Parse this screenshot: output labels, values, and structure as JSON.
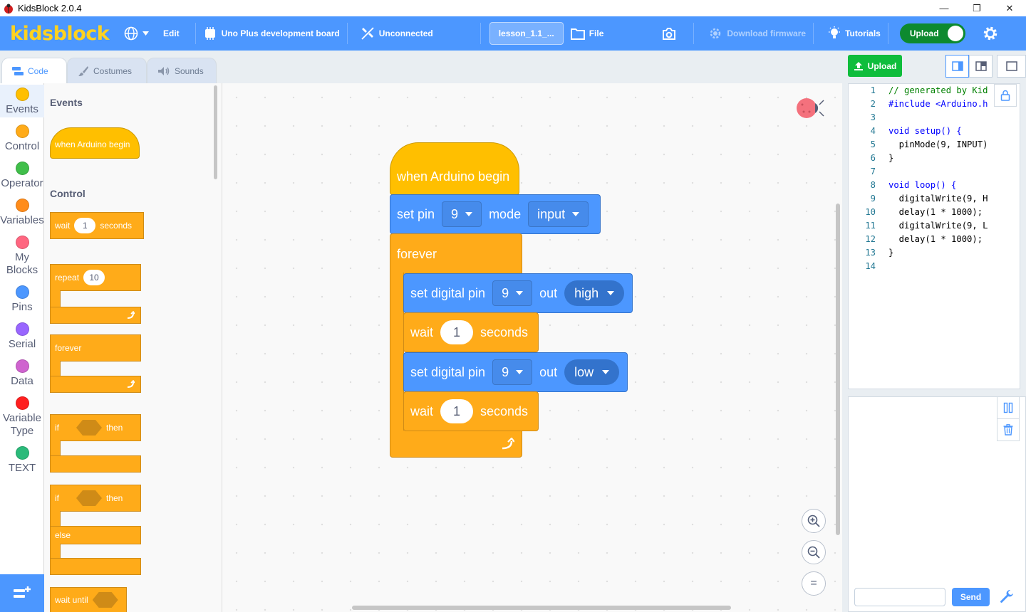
{
  "window": {
    "title": "KidsBlock 2.0.4",
    "minimize": "—",
    "maximize": "❐",
    "close": "✕"
  },
  "menu": {
    "logo": "kidsblock",
    "edit": "Edit",
    "board": "Uno Plus development board",
    "connection": "Unconnected",
    "project_name": "lesson_1.1_...",
    "file": "File",
    "download_firmware": "Download firmware",
    "tutorials": "Tutorials",
    "upload_mode": "Upload"
  },
  "tabs": [
    {
      "label": "Code"
    },
    {
      "label": "Costumes"
    },
    {
      "label": "Sounds"
    }
  ],
  "categories": [
    {
      "label": "Events",
      "color": "#ffbf00"
    },
    {
      "label": "Control",
      "color": "#ffab19"
    },
    {
      "label": "Operator",
      "color": "#40bf4a"
    },
    {
      "label": "Variables",
      "color": "#ff8c1a"
    },
    {
      "label": "My Blocks",
      "color": "#ff6680"
    },
    {
      "label": "Pins",
      "color": "#4c97ff"
    },
    {
      "label": "Serial",
      "color": "#9966ff"
    },
    {
      "label": "Data",
      "color": "#cf63cf"
    },
    {
      "label": "Variable Type",
      "color": "#ff1f1f"
    },
    {
      "label": "TEXT",
      "color": "#2bba7a"
    }
  ],
  "palette": {
    "events_title": "Events",
    "when_begin": "when Arduino begin",
    "control_title": "Control",
    "wait": "wait",
    "wait_value": "1",
    "seconds": "seconds",
    "repeat": "repeat",
    "repeat_value": "10",
    "forever": "forever",
    "if": "if",
    "then": "then",
    "if2": "if",
    "then2": "then",
    "else": "else",
    "wait_until": "wait until"
  },
  "script": {
    "hat": "when Arduino begin",
    "set_pin": "set pin",
    "pin": "9",
    "mode": "mode",
    "mode_value": "input",
    "forever": "forever",
    "set_digital_pin": "set digital pin",
    "out": "out",
    "level_high": "high",
    "level_low": "low",
    "wait": "wait",
    "wait_value": "1",
    "seconds": "seconds"
  },
  "zoom": {
    "in": "+",
    "out": "−",
    "reset": "="
  },
  "right_panel": {
    "upload_button": "Upload",
    "code_lines": [
      {
        "n": "1",
        "text": "// generated by Kid"
      },
      {
        "n": "2",
        "text": "#include <Arduino.h"
      },
      {
        "n": "3",
        "text": ""
      },
      {
        "n": "4",
        "text": "void setup() {"
      },
      {
        "n": "5",
        "text": "  pinMode(9, INPUT)"
      },
      {
        "n": "6",
        "text": "}"
      },
      {
        "n": "7",
        "text": ""
      },
      {
        "n": "8",
        "text": "void loop() {"
      },
      {
        "n": "9",
        "text": "  digitalWrite(9, H"
      },
      {
        "n": "10",
        "text": "  delay(1 * 1000);"
      },
      {
        "n": "11",
        "text": "  digitalWrite(9, L"
      },
      {
        "n": "12",
        "text": "  delay(1 * 1000);"
      },
      {
        "n": "13",
        "text": "}"
      },
      {
        "n": "14",
        "text": ""
      }
    ],
    "serial_input_placeholder": "",
    "send_button": "Send"
  }
}
